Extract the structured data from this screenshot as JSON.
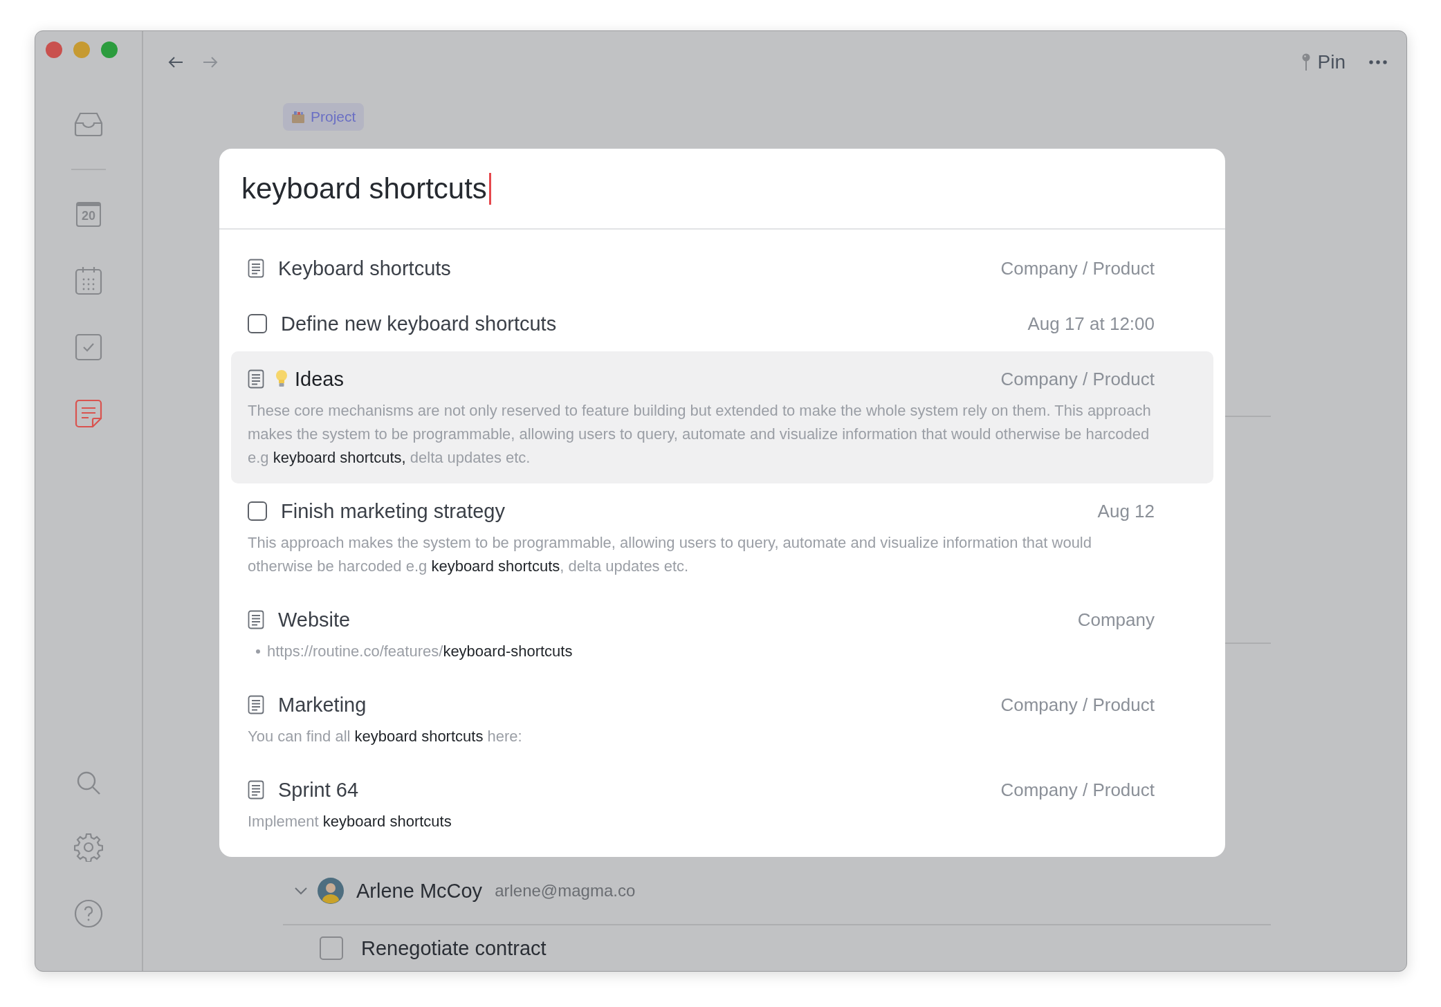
{
  "sidebar": {
    "items": [
      {
        "kind": "inbox",
        "selected": false
      },
      {
        "kind": "today",
        "label": "20",
        "selected": false
      },
      {
        "kind": "calendar",
        "selected": false
      },
      {
        "kind": "tasks",
        "selected": false
      },
      {
        "kind": "notes",
        "selected": true
      }
    ],
    "bottom_items": [
      {
        "kind": "search"
      },
      {
        "kind": "settings"
      },
      {
        "kind": "help"
      }
    ]
  },
  "toolbar": {
    "pin_label": "Pin"
  },
  "project_tag": {
    "label": "Project"
  },
  "search": {
    "value": "keyboard shortcuts"
  },
  "results": [
    {
      "kind": "note",
      "title": "Keyboard shortcuts",
      "meta": "Company / Product",
      "selected": false
    },
    {
      "kind": "task",
      "title": "Define new keyboard shortcuts",
      "meta": "Aug 17 at 12:00",
      "checked": false,
      "selected": false
    },
    {
      "kind": "note",
      "emoji_icon": true,
      "title": "Ideas",
      "meta": "Company / Product",
      "snippet": "These core mechanisms are not only reserved to feature building but extended to make the whole system rely on them. This approach makes the system to be programmable, allowing users to query, automate and visualize information that would otherwise be harcoded e.g **keyboard shortcuts,** delta updates etc.",
      "selected": true
    },
    {
      "kind": "task",
      "title": "Finish marketing strategy",
      "meta": "Aug 12",
      "checked": false,
      "snippet": "This approach makes the system to be programmable, allowing users to query, automate and visualize information that would otherwise be harcoded e.g **keyboard shortcuts**, delta updates etc.",
      "selected": false
    },
    {
      "kind": "note",
      "title": "Website",
      "meta": "Company",
      "link": "https://routine.co/features/**keyboard-shortcuts**",
      "selected": false
    },
    {
      "kind": "note",
      "title": "Marketing",
      "meta": "Company / Product",
      "snippet": "You can find all **keyboard shortcuts** here:",
      "selected": false
    },
    {
      "kind": "note",
      "title": "Sprint 64",
      "meta": "Company / Product",
      "snippet": "Implement **keyboard shortcuts**",
      "selected": false
    }
  ],
  "background": {
    "person": {
      "name": "Arlene McCoy",
      "email": "arlene@magma.co",
      "expanded": true
    },
    "task": {
      "title": "Renegotiate contract",
      "checked": false
    }
  }
}
